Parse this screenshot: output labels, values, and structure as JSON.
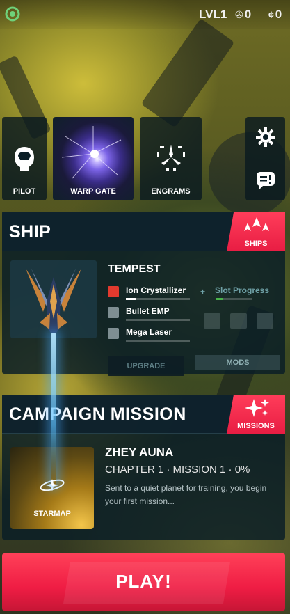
{
  "topbar": {
    "level": "LVL1",
    "gems": "0",
    "credits": "0",
    "gem_icon": "gem-icon",
    "credit_icon": "credit-icon"
  },
  "tiles": {
    "pilot": "PILOT",
    "warp_gate": "WARP GATE",
    "engrams": "ENGRAMS"
  },
  "ship": {
    "header": "SHIP",
    "ships_button": "SHIPS",
    "name": "TEMPEST",
    "weapons": [
      {
        "name": "Ion Crystallizer",
        "progress": 0.15,
        "active": true
      },
      {
        "name": "Bullet EMP",
        "progress": 0.0,
        "active": false
      },
      {
        "name": "Mega Laser",
        "progress": 0.0,
        "active": false
      }
    ],
    "slot_progress_label": "Slot Progress",
    "slot_progress": 0.2,
    "upgrade_label": "UPGRADE",
    "mods_label": "MODS"
  },
  "campaign": {
    "header": "CAMPAIGN MISSION",
    "missions_button": "MISSIONS",
    "starmap_label": "STARMAP",
    "mission_name": "ZHEY AUNA",
    "chapter": "CHAPTER 1 · MISSION 1 · 0%",
    "description": "Sent to a quiet planet for training, you begin your first mission..."
  },
  "play": {
    "label": "PLAY!"
  },
  "colors": {
    "accent_red": "#ef1d44",
    "panel": "#0a1e26",
    "slot_green": "#49b24a"
  }
}
